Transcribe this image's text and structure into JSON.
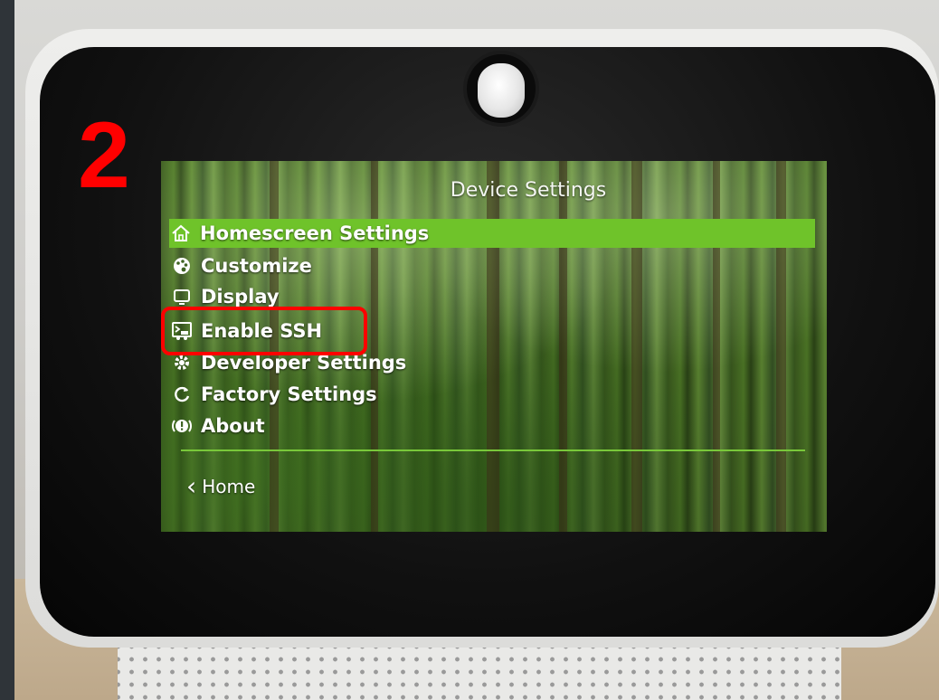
{
  "annotation": {
    "step_number": "2",
    "highlight_color": "#ff0000"
  },
  "screen": {
    "title": "Device Settings",
    "accent_color": "#6fc32a",
    "menu": [
      {
        "label": "Homescreen Settings",
        "icon": "home-icon",
        "selected": true
      },
      {
        "label": "Customize",
        "icon": "palette-icon",
        "selected": false
      },
      {
        "label": "Display",
        "icon": "display-icon",
        "selected": false
      },
      {
        "label": "Enable SSH",
        "icon": "terminal-icon",
        "selected": false
      },
      {
        "label": "Developer Settings",
        "icon": "gear-icon",
        "selected": false
      },
      {
        "label": "Factory Settings",
        "icon": "refresh-icon",
        "selected": false
      },
      {
        "label": "About",
        "icon": "info-icon",
        "selected": false
      }
    ],
    "back": {
      "label": "Home",
      "icon": "chevron-left-icon"
    }
  }
}
